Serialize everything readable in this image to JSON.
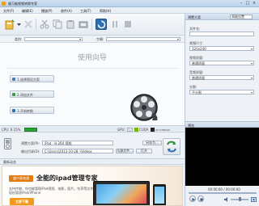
{
  "window": {
    "title": "顺万能视频转换专家",
    "min": "–",
    "max": "□",
    "close": "×"
  },
  "menu": [
    "文件(F)",
    "编辑(E)",
    "播放(P)",
    "收件(A)",
    "工具(T)",
    "帮助(H)"
  ],
  "filterbar": {
    "label1": "类别:",
    "label2": "字幕:"
  },
  "guide": {
    "title": "使用向导",
    "steps": [
      "1.选择预设方案",
      "2.添加文件",
      "3.开始转换"
    ]
  },
  "status": {
    "cpu": "CPU: 6.15%",
    "gpu": "GPU:",
    "cuda": "CUDA",
    "amd": "ATI STREAM"
  },
  "output": {
    "format_label": "预置方案(P):",
    "format_value": "iPod - H.264 视频",
    "saveas_label": "另存为...",
    "dir_label": "输出目录(D):",
    "dir_value": "C:\\Users\\2013-10-28 -\\Videos",
    "same_src": "与源文件...",
    "open": "打开"
  },
  "news": {
    "header": "最新动态"
  },
  "banner": {
    "brand": "盛兴泰铭通",
    "headline": "全能的ipad管理专家",
    "sub1": "支持传输，你也能管理iPad视频、电影，照片，铃声等文件",
    "sub2": "轻松管理iPod/iPhone",
    "cta": "立即下载"
  },
  "rightpanel": {
    "header": "预置方案",
    "header_select": "高级设置",
    "fields": [
      {
        "label": "文件名:",
        "value": ""
      },
      {
        "label": "视频尺寸:",
        "value": "320x240"
      },
      {
        "label": "视频质量:",
        "value": "普通质量"
      },
      {
        "label": "音频质量:",
        "value": "普通质量"
      },
      {
        "label": "分割:",
        "value": "不分割"
      }
    ]
  },
  "preview": {
    "header": "预览",
    "time": "00:00:00 / 00:00:00"
  }
}
